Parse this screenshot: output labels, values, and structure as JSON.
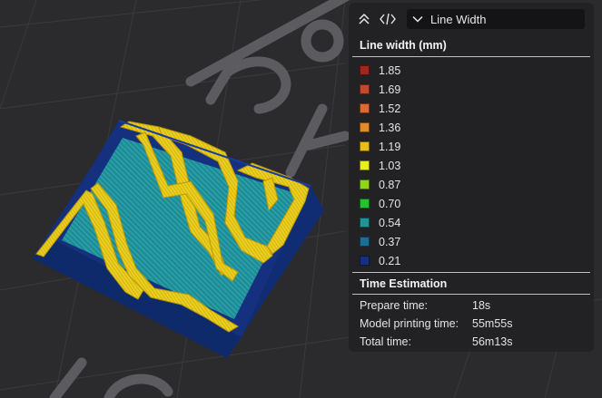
{
  "toolbar": {
    "collapse_icon": "double-chevron-up-icon",
    "code_icon": "code-brackets-icon",
    "view_dropdown_icon": "chevron-down-icon",
    "view_type": "Line Width"
  },
  "legend": {
    "title": "Line width (mm)",
    "items": [
      {
        "label": "1.85",
        "color": "#a3261c"
      },
      {
        "label": "1.69",
        "color": "#c2482e"
      },
      {
        "label": "1.52",
        "color": "#de6a33"
      },
      {
        "label": "1.36",
        "color": "#e38a2d"
      },
      {
        "label": "1.19",
        "color": "#e9bf16"
      },
      {
        "label": "1.03",
        "color": "#e8ef1d"
      },
      {
        "label": "0.87",
        "color": "#8fd61a"
      },
      {
        "label": "0.70",
        "color": "#22c42c"
      },
      {
        "label": "0.54",
        "color": "#1f9598"
      },
      {
        "label": "0.37",
        "color": "#1a6f95"
      },
      {
        "label": "0.21",
        "color": "#14307f"
      }
    ]
  },
  "time_estimation": {
    "title": "Time Estimation",
    "rows": [
      {
        "label": "Prepare time:",
        "value": "18s"
      },
      {
        "label": "Model printing time:",
        "value": "55m55s"
      },
      {
        "label": "Total time:",
        "value": "56m13s"
      }
    ]
  },
  "colors": {
    "background": "#2b2b2e",
    "panel": "#222224",
    "wall": "#e5c60f",
    "infill": "#1f8d95",
    "base": "#14307f"
  }
}
